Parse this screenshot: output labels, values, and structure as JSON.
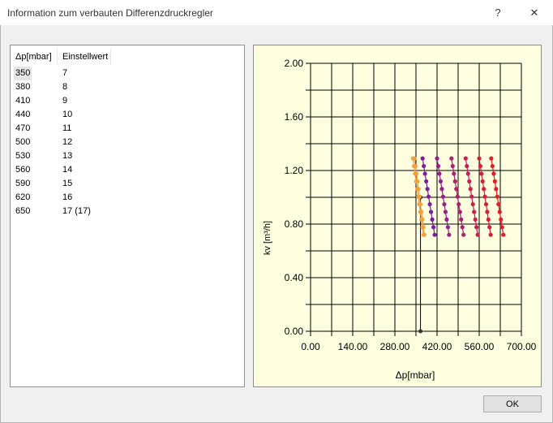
{
  "window": {
    "title": "Information zum verbauten Differenzdruckregler",
    "help_glyph": "?",
    "close_glyph": "✕"
  },
  "table": {
    "columns": [
      "Δp[mbar]",
      "Einstellwert"
    ],
    "rows": [
      [
        "350",
        "7"
      ],
      [
        "380",
        "8"
      ],
      [
        "410",
        "9"
      ],
      [
        "440",
        "10"
      ],
      [
        "470",
        "11"
      ],
      [
        "500",
        "12"
      ],
      [
        "530",
        "13"
      ],
      [
        "560",
        "14"
      ],
      [
        "590",
        "15"
      ],
      [
        "620",
        "16"
      ],
      [
        "650",
        "17 (17)"
      ]
    ],
    "selected_index": 0
  },
  "chart_data": {
    "type": "scatter",
    "xlabel": "Δp[mbar]",
    "ylabel": "kv  [m³/h]",
    "xlim": [
      0,
      700
    ],
    "ylim": [
      0,
      2.0
    ],
    "x_ticks": [
      "0.00",
      "140.00",
      "280.00",
      "420.00",
      "560.00",
      "700.00"
    ],
    "y_ticks": [
      "0.00",
      "0.40",
      "0.80",
      "1.20",
      "1.60",
      "2.00"
    ],
    "grid": true,
    "marker": {
      "x": 365,
      "y": 1.0,
      "baseline_y": 0
    },
    "series": [
      {
        "color": "#f4a040",
        "x_top": 340,
        "x_bottom": 375
      },
      {
        "color": "#f4a040",
        "x_top": 345,
        "x_bottom": 378
      },
      {
        "color": "#7a1fa0",
        "x_top": 372,
        "x_bottom": 412
      },
      {
        "color": "#9a1f8c",
        "x_top": 420,
        "x_bottom": 460
      },
      {
        "color": "#b01f70",
        "x_top": 468,
        "x_bottom": 508
      },
      {
        "color": "#c81f50",
        "x_top": 515,
        "x_bottom": 555
      },
      {
        "color": "#d81f38",
        "x_top": 560,
        "x_bottom": 598
      },
      {
        "color": "#e01f28",
        "x_top": 600,
        "x_bottom": 640
      }
    ],
    "y_top": 1.29,
    "y_bottom": 0.72,
    "points_per_series": 11
  },
  "buttons": {
    "ok": "OK"
  }
}
